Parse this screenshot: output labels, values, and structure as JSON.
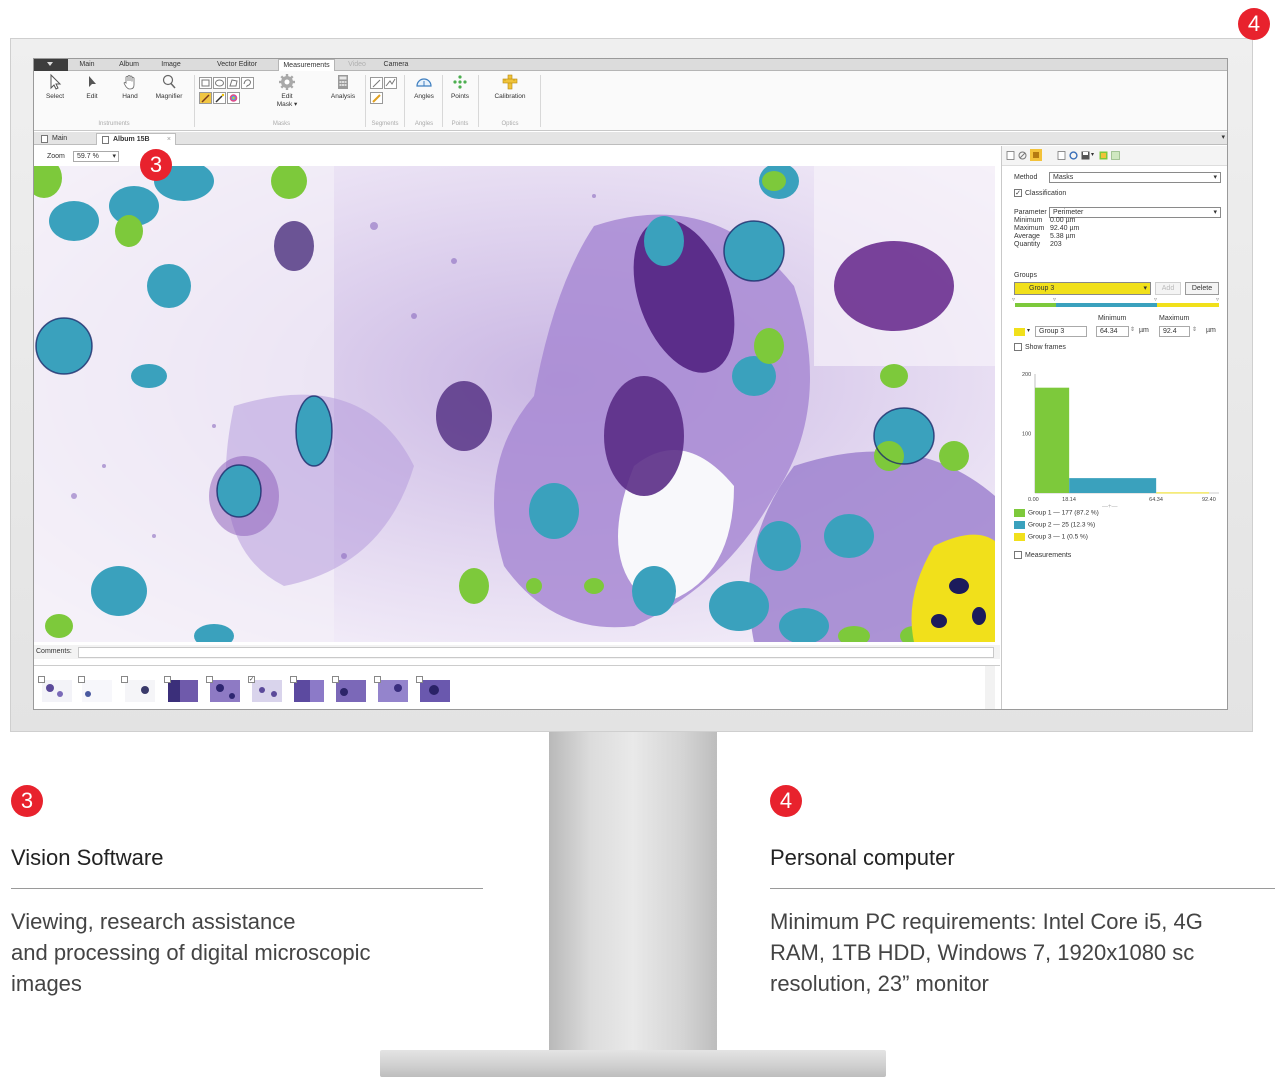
{
  "menu": {
    "tabs": [
      {
        "label": "Main"
      },
      {
        "label": "Album"
      },
      {
        "label": "Image"
      },
      {
        "label": "Vector Editor"
      },
      {
        "label": "Measurements"
      },
      {
        "label": "Video"
      },
      {
        "label": "Camera"
      }
    ],
    "active_tab": "Measurements",
    "disabled_tab": "Video"
  },
  "ribbon": {
    "select": "Select",
    "edit": "Edit",
    "hand": "Hand",
    "magnifier": "Magnifier",
    "edit_mask_line1": "Edit",
    "edit_mask_line2": "Mask ▾",
    "analysis": "Analysis",
    "angles": "Angles",
    "points": "Points",
    "calibration": "Calibration",
    "groups": {
      "instruments": "Instruments",
      "masks": "Masks",
      "segments": "Segments",
      "angles": "Angles",
      "points": "Points",
      "optics": "Optics"
    }
  },
  "doc_tabs": {
    "main": "Main",
    "album": "Album 15B",
    "close": "×"
  },
  "zoom": {
    "label": "Zoom",
    "value": "59.7 %"
  },
  "comments": {
    "label": "Comments:",
    "value": ""
  },
  "panel": {
    "method_label": "Method",
    "method_value": "Masks",
    "classification_label": "Classification",
    "classification_checked": true,
    "parameter_label": "Parameter",
    "parameter_value": "Perimeter",
    "stats": [
      {
        "label": "Minimum",
        "value": "0.00 µm"
      },
      {
        "label": "Maximum",
        "value": "92.40 µm"
      },
      {
        "label": "Average",
        "value": "5.38 µm"
      },
      {
        "label": "Quantity",
        "value": "203"
      }
    ],
    "groups_label": "Groups",
    "group_select": "Group 3",
    "add_button": "Add",
    "delete_button": "Delete",
    "minimum_label": "Minimum",
    "maximum_label": "Maximum",
    "group_name": "Group 3",
    "min_value": "64.34",
    "max_value": "92.4",
    "unit": "µm",
    "show_frames_label": "Show frames",
    "measurements_label": "Measurements"
  },
  "chart_data": {
    "type": "bar",
    "title": "",
    "xlabel": "",
    "ylabel": "",
    "x_ticks": [
      "0.00",
      "18.14",
      "64.34",
      "92.40"
    ],
    "y_ticks": [
      "200",
      "100"
    ],
    "ylim": [
      0,
      200
    ],
    "bins": [
      {
        "from": 0.0,
        "to": 18.14,
        "value": 177,
        "group": "Group 1",
        "color": "#7dc93b"
      },
      {
        "from": 18.14,
        "to": 64.34,
        "value": 25,
        "group": "Group 2",
        "color": "#3aa1bd"
      },
      {
        "from": 64.34,
        "to": 92.4,
        "value": 1,
        "group": "Group 3",
        "color": "#f1e01b"
      }
    ],
    "legend": [
      {
        "label": "Group 1 — 177 (87.2 %)",
        "color": "#7dc93b"
      },
      {
        "label": "Group 2 — 25 (12.3 %)",
        "color": "#3aa1bd"
      },
      {
        "label": "Group 3 — 1 (0.5 %)",
        "color": "#f1e01b"
      }
    ]
  },
  "badges": {
    "software": "3",
    "computer": "4"
  },
  "captions": {
    "software_title": "Vision Software",
    "software_text_1": "Viewing, research assistance",
    "software_text_2": "and processing of digital microscopic",
    "software_text_3": "images",
    "computer_title": "Personal computer",
    "computer_text_1": "Minimum PC requirements: Intel Core i5, 4G",
    "computer_text_2": "RAM, 1TB HDD, Windows 7, 1920x1080 sc",
    "computer_text_3": "resolution, 23” monitor"
  },
  "colors": {
    "accent_red": "#e8222d",
    "group1": "#7dc93b",
    "group2": "#3aa1bd",
    "group3": "#f1e01b"
  }
}
